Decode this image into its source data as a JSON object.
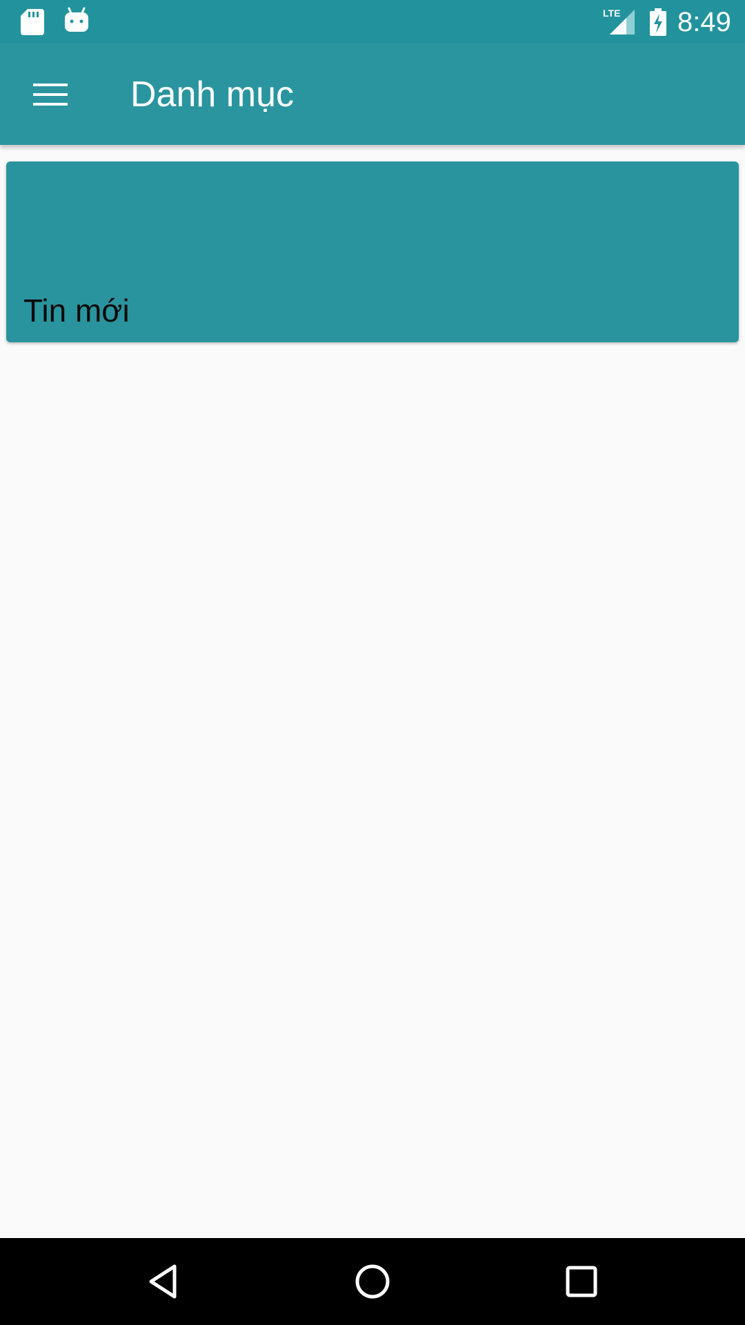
{
  "status_bar": {
    "time": "8:49",
    "network": "LTE",
    "icons": [
      "sd-card-icon",
      "android-icon",
      "lte-signal-icon",
      "battery-charging-icon"
    ]
  },
  "app_bar": {
    "title": "Danh mục",
    "menu_icon": "hamburger-menu-icon"
  },
  "categories": [
    {
      "label": "Tin mới"
    }
  ],
  "nav_bar": {
    "icons": [
      "back-icon",
      "home-icon",
      "recents-icon"
    ]
  },
  "colors": {
    "primary": "#2a959f",
    "status_bar": "#22939d",
    "card": "#2a949e",
    "background": "#fafafa",
    "nav_bar": "#000000"
  }
}
